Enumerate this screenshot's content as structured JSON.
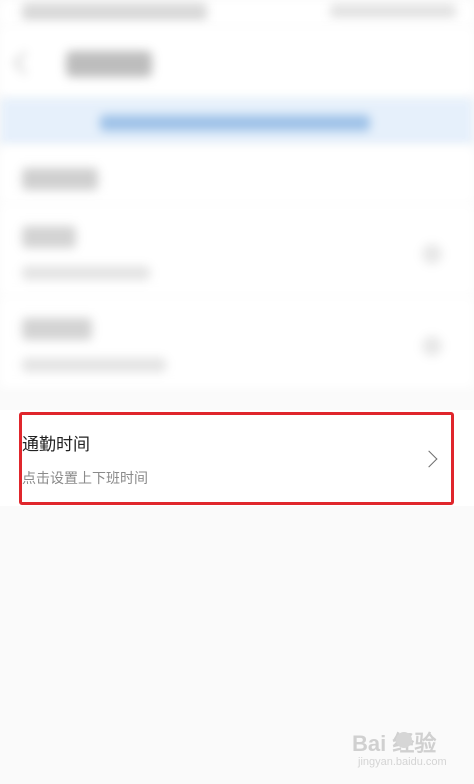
{
  "commute": {
    "title": "通勤时间",
    "subtitle": "点击设置上下班时间"
  },
  "watermark": {
    "brand": "Bai  经验",
    "url": "jingyan.baidu.com"
  },
  "colors": {
    "highlight_border": "#e0262c",
    "banner_background": "#e6f0fb",
    "primary_text": "#222222",
    "secondary_text": "#8a8a8a"
  },
  "icons": {
    "back": "arrow-left-icon",
    "disclosure": "chevron-right-icon"
  }
}
